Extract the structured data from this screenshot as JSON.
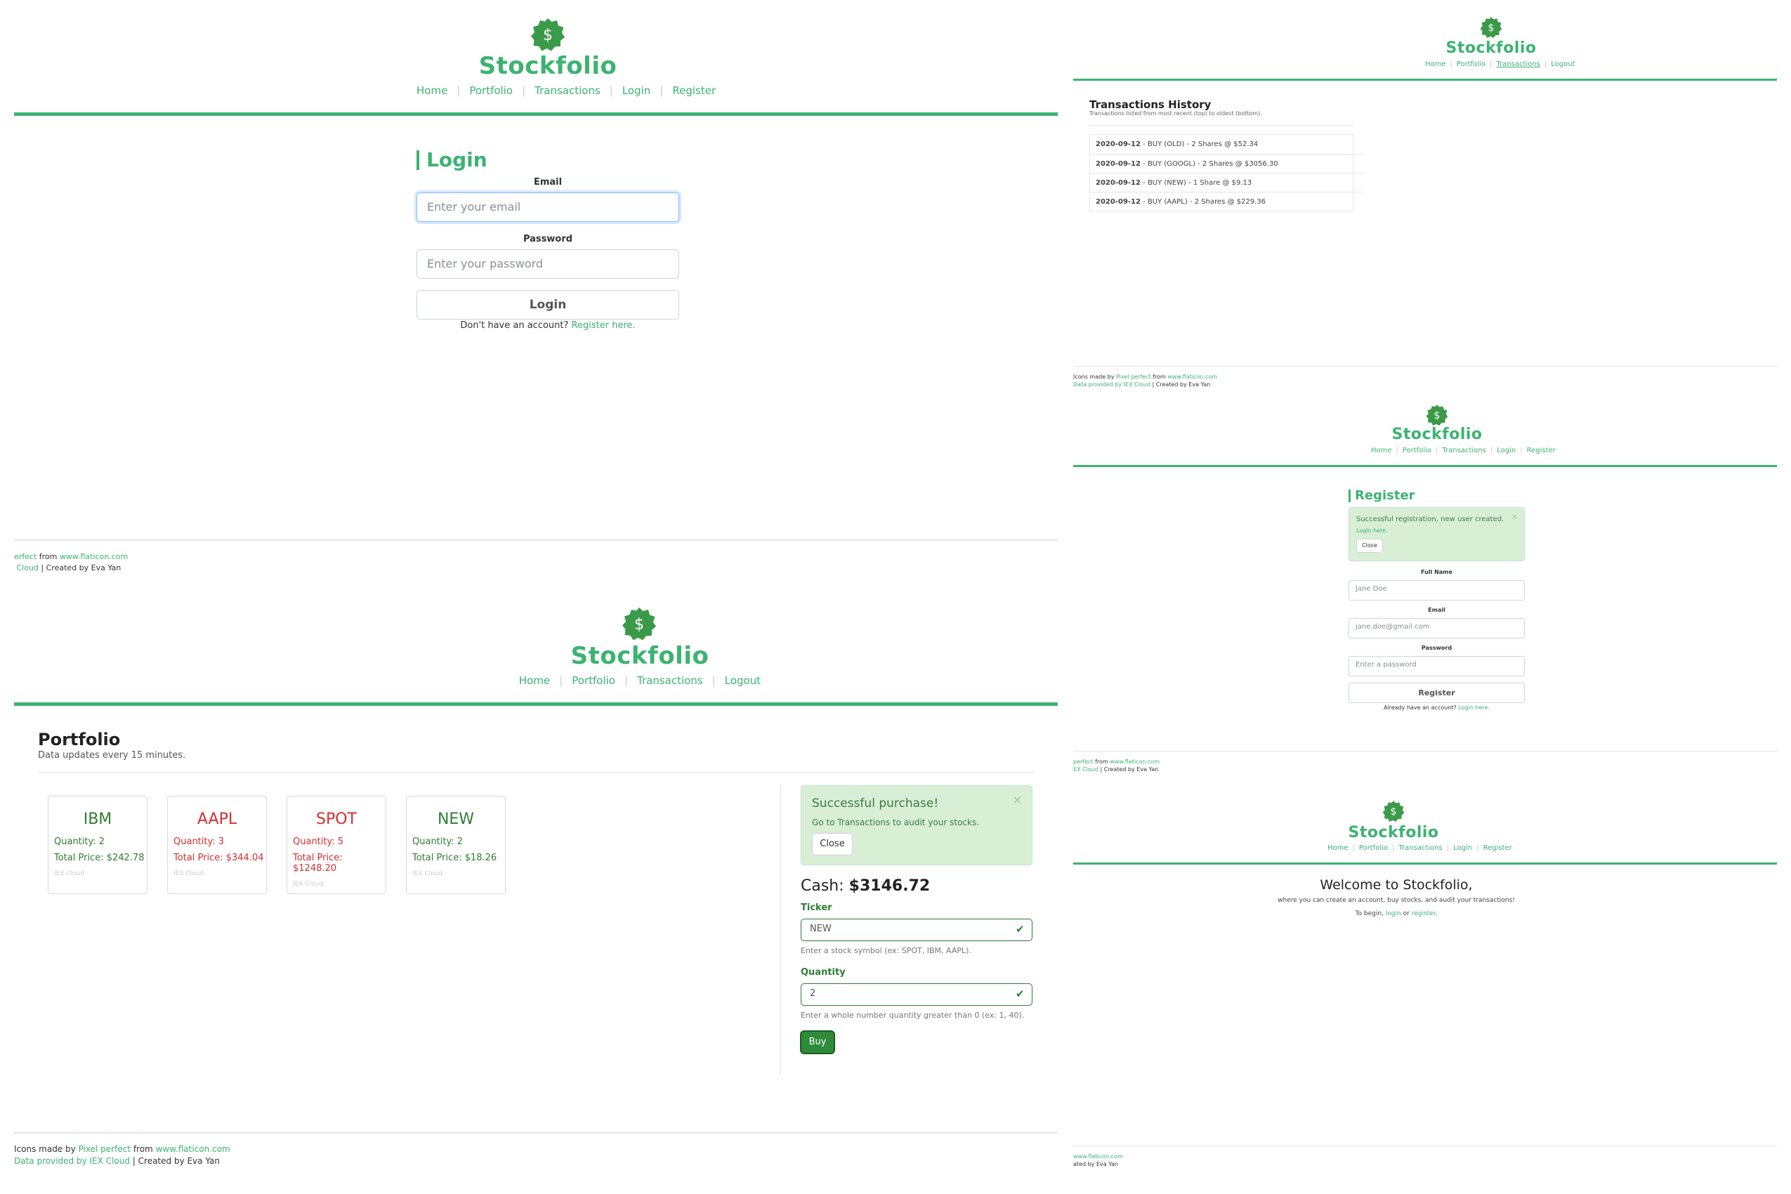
{
  "brand": "Stockfolio",
  "dollar_glyph": "$",
  "nav_guest": [
    "Home",
    "Portfolio",
    "Transactions",
    "Login",
    "Register"
  ],
  "nav_user": [
    "Home",
    "Portfolio",
    "Transactions",
    "Logout"
  ],
  "footer": {
    "icons_prefix": "Icons made by",
    "icons_author": "Pixel perfect",
    "from": "from",
    "icons_site": "www.flaticon.com",
    "data_provider": "Data provided by IEX Cloud",
    "sep": "|",
    "created_by": "Created by Eva Yan"
  },
  "login": {
    "heading": "Login",
    "email_label": "Email",
    "email_placeholder": "Enter your email",
    "password_label": "Password",
    "password_placeholder": "Enter your password",
    "button": "Login",
    "no_account": "Don't have an account?",
    "register_link": "Register here."
  },
  "portfolio": {
    "heading": "Portfolio",
    "subtitle": "Data updates every 15 minutes.",
    "stocks": [
      {
        "ticker": "IBM",
        "quantity": "Quantity: 2",
        "total": "Total Price: $242.78",
        "source": "IEX Cloud",
        "trend": "up"
      },
      {
        "ticker": "AAPL",
        "quantity": "Quantity: 3",
        "total": "Total Price: $344.04",
        "source": "IEX Cloud",
        "trend": "down"
      },
      {
        "ticker": "SPOT",
        "quantity": "Quantity: 5",
        "total": "Total Price: $1248.20",
        "source": "IEX Cloud",
        "trend": "down"
      },
      {
        "ticker": "NEW",
        "quantity": "Quantity: 2",
        "total": "Total Price: $18.26",
        "source": "IEX Cloud",
        "trend": "up"
      }
    ],
    "alert": {
      "title": "Successful purchase!",
      "message": "Go to Transactions to audit your stocks.",
      "close": "Close",
      "dismiss": "×"
    },
    "cash_label": "Cash:",
    "cash_value": "$3146.72",
    "ticker_label": "Ticker",
    "ticker_value": "NEW",
    "ticker_help": "Enter a stock symbol (ex: SPOT, IBM, AAPL).",
    "quantity_label": "Quantity",
    "quantity_value": "2",
    "quantity_help": "Enter a whole number quantity greater than 0 (ex: 1, 40).",
    "buy": "Buy",
    "check": "✔"
  },
  "transactions": {
    "heading": "Transactions History",
    "subtitle": "Transactions listed from most recent (top) to oldest (bottom).",
    "rows": [
      {
        "date": "2020-09-12",
        "detail": "BUY (OLD) - 2 Shares @ $52.34"
      },
      {
        "date": "2020-09-12",
        "detail": "BUY (GOOGL) - 2 Shares @ $3056.30"
      },
      {
        "date": "2020-09-12",
        "detail": "BUY (NEW) - 1 Share @ $9.13"
      },
      {
        "date": "2020-09-12",
        "detail": "BUY (AAPL) - 2 Shares @ $229.36"
      }
    ]
  },
  "register": {
    "heading": "Register",
    "alert_msg": "Successful registration, new user created.",
    "alert_link": "Login here.",
    "alert_close": "Close",
    "dismiss": "×",
    "fullname_label": "Full Name",
    "fullname_placeholder": "Jane Doe",
    "email_label": "Email",
    "email_placeholder": "jane.doe@gmail.com",
    "password_label": "Password",
    "password_placeholder": "Enter a password",
    "button": "Register",
    "have_account": "Already have an account?",
    "login_link": "Login here."
  },
  "welcome": {
    "title": "Welcome to Stockfolio,",
    "line": "where you can create an account, buy stocks, and audit your transactions!",
    "begin": "To begin,",
    "login": "login",
    "or": "or",
    "register": "register",
    "end": "."
  },
  "colors": {
    "accent": "#3cb371",
    "loss": "#d32f2f",
    "gain": "#2e7d32"
  }
}
